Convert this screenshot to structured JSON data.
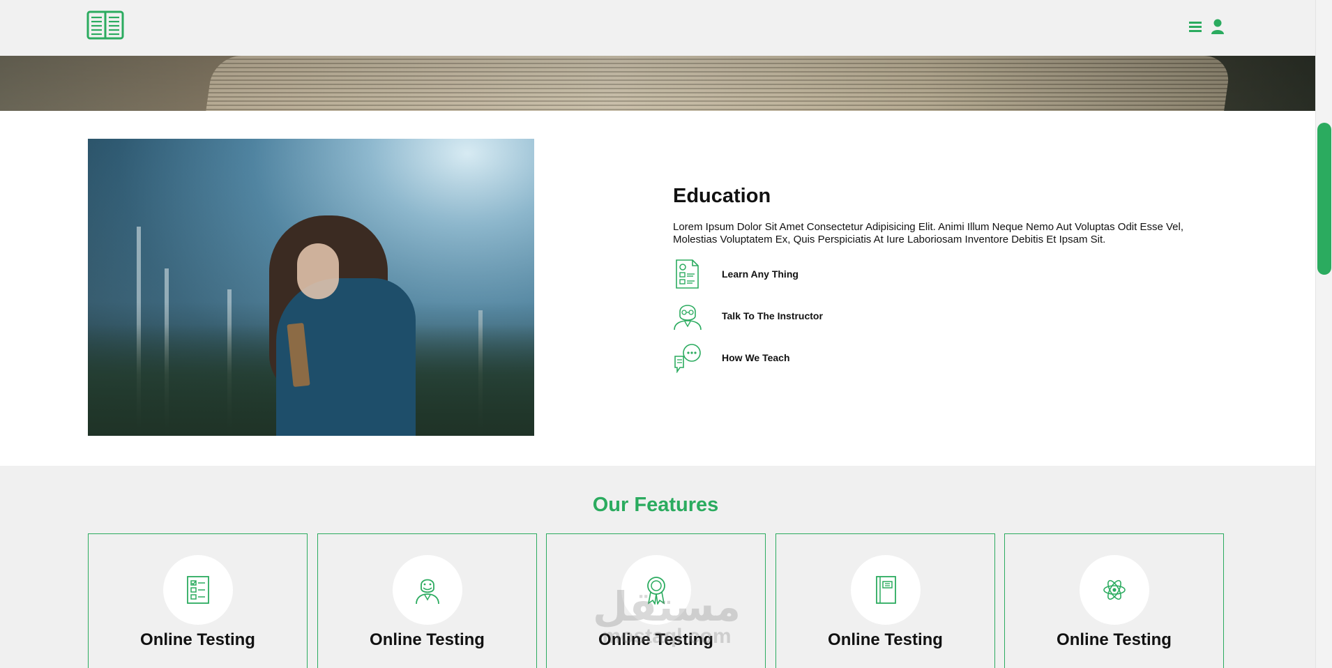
{
  "colors": {
    "accent": "#2bab5f",
    "background": "#f0f0f0",
    "text": "#111111"
  },
  "header": {
    "logo_icon": "open-book-icon",
    "menu_icon": "hamburger-menu-icon",
    "user_icon": "user-icon"
  },
  "education": {
    "title": "Education",
    "description": "Lorem Ipsum Dolor Sit Amet Consectetur Adipisicing Elit. Animi Illum Neque Nemo Aut Voluptas Odit Esse Vel, Molestias Voluptatem Ex, Quis Perspiciatis At Iure Laboriosam Inventore Debitis Et Ipsam Sit.",
    "items": [
      {
        "icon": "document-list-icon",
        "label": "Learn Any Thing"
      },
      {
        "icon": "instructor-icon",
        "label": "Talk To The Instructor"
      },
      {
        "icon": "chat-bubbles-icon",
        "label": "How We Teach"
      }
    ]
  },
  "features": {
    "title": "Our Features",
    "cards": [
      {
        "icon": "checklist-icon",
        "title": "Online Testing"
      },
      {
        "icon": "teacher-icon",
        "title": "Online Testing"
      },
      {
        "icon": "award-badge-icon",
        "title": "Online Testing"
      },
      {
        "icon": "notebook-icon",
        "title": "Online Testing"
      },
      {
        "icon": "atom-icon",
        "title": "Online Testing"
      }
    ]
  },
  "watermark": {
    "arabic": "مستقل",
    "latin": "mostaql.com"
  }
}
